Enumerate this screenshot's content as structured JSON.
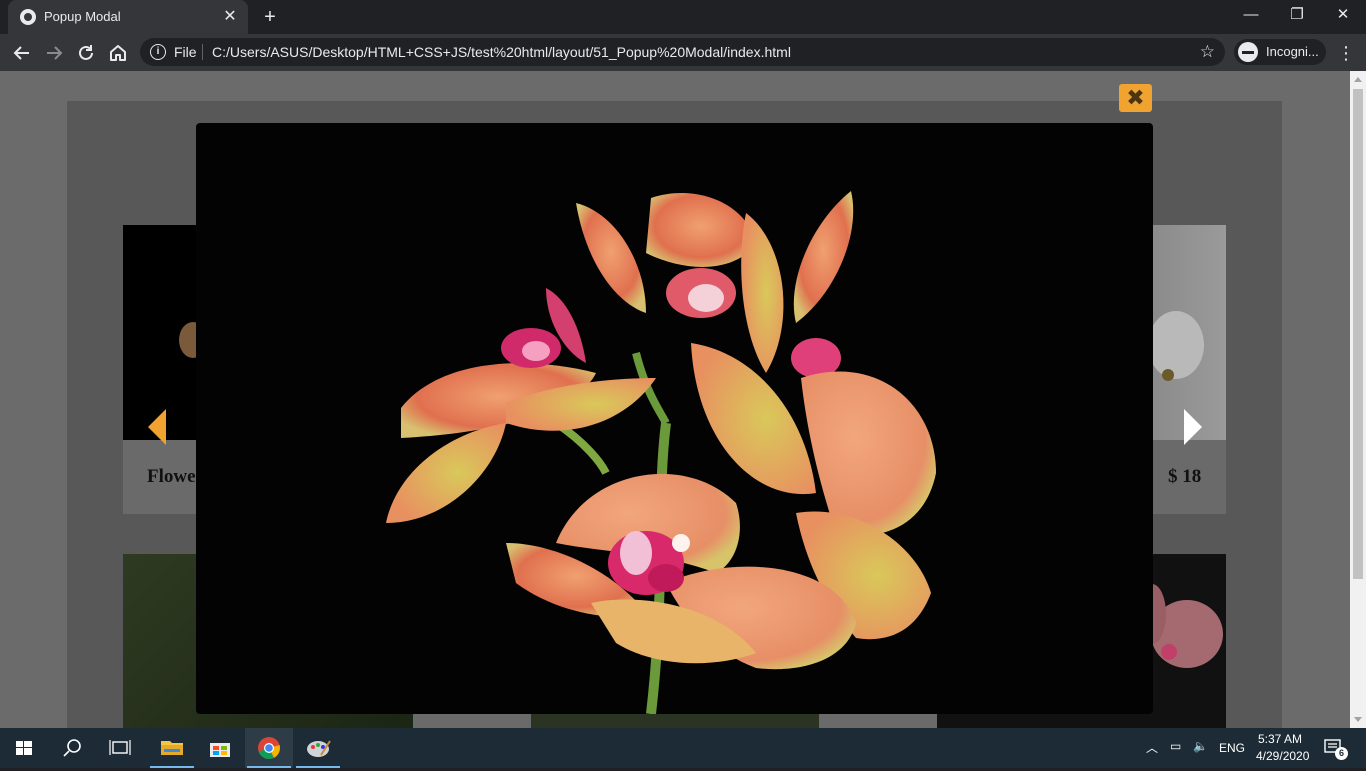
{
  "browser": {
    "tab_title": "Popup Modal",
    "tab_close": "✕",
    "new_tab": "+",
    "url_scheme": "File",
    "url": "C:/Users/ASUS/Desktop/HTML+CSS+JS/test%20html/layout/51_Popup%20Modal/index.html",
    "profile_label": "Incogni...",
    "window_controls": {
      "minimize": "—",
      "restore": "❐",
      "close": "✕"
    }
  },
  "page": {
    "product_name": "Flowe",
    "product_price": "$ 18"
  },
  "modal": {
    "close_label": "✖",
    "image_subject": "orchid-photo"
  },
  "taskbar": {
    "time": "5:37 AM",
    "date": "4/29/2020",
    "language": "ENG",
    "notification_count": "6"
  },
  "colors": {
    "accent_orange": "#f0a331",
    "modal_bg": "#030303",
    "overlay": "#6b6b6b"
  }
}
